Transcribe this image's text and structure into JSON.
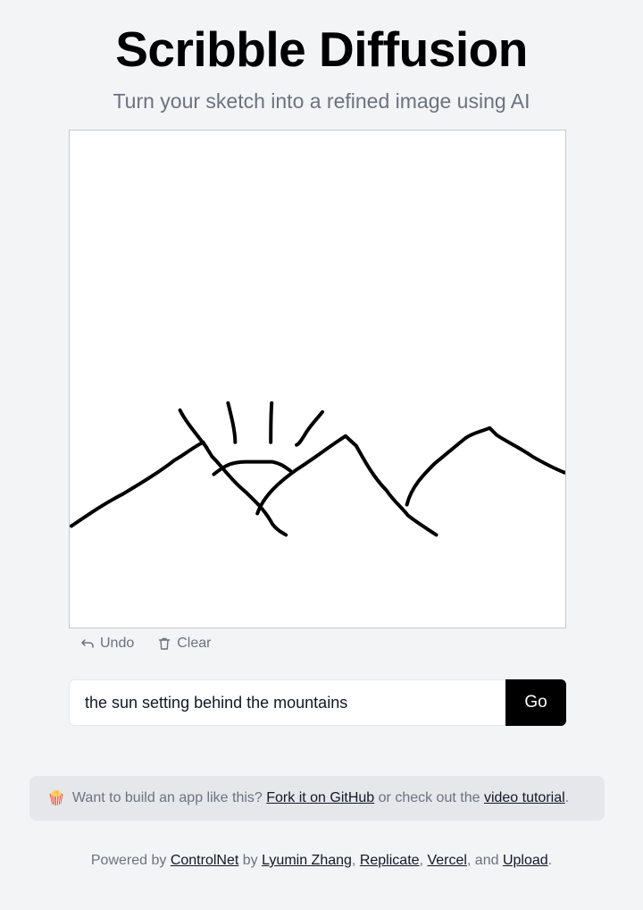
{
  "header": {
    "title": "Scribble Diffusion",
    "subtitle": "Turn your sketch into a refined image using AI"
  },
  "toolbar": {
    "undo_label": "Undo",
    "clear_label": "Clear"
  },
  "prompt": {
    "value": "the sun setting behind the mountains",
    "submit_label": "Go"
  },
  "banner": {
    "icon": "popcorn-icon",
    "emoji": "🍿",
    "text_1": "Want to build an app like this?",
    "link_github": "Fork it on GitHub",
    "text_2": "or check out the",
    "link_video": "video tutorial",
    "text_3": "."
  },
  "footer": {
    "text_1": "Powered by",
    "link_controlnet": "ControlNet",
    "text_2": "by",
    "link_author": "Lyumin Zhang",
    "sep_1": ",",
    "link_replicate": "Replicate",
    "sep_2": ",",
    "link_vercel": "Vercel",
    "text_3": ", and",
    "link_upload": "Upload",
    "text_4": "."
  },
  "colors": {
    "background": "#f3f4f6",
    "accent": "#000000",
    "muted_text": "#6b7280",
    "banner_bg": "#e5e7eb"
  }
}
